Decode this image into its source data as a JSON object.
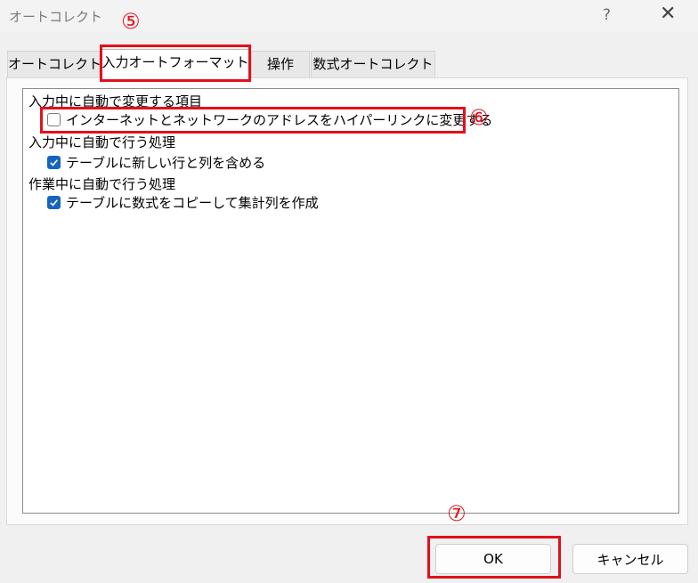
{
  "window": {
    "title": "オートコレクト",
    "help_glyph": "?",
    "close_glyph": "✕"
  },
  "tabs": [
    {
      "label": "オートコレクト"
    },
    {
      "label": "入力オートフォーマット"
    },
    {
      "label": "操作"
    },
    {
      "label": "数式オートコレクト"
    }
  ],
  "sections": [
    {
      "heading": "入力中に自動で変更する項目",
      "options": [
        {
          "label": "インターネットとネットワークのアドレスをハイパーリンクに変更する",
          "checked": false
        }
      ]
    },
    {
      "heading": "入力中に自動で行う処理",
      "options": [
        {
          "label": "テーブルに新しい行と列を含める",
          "checked": true
        }
      ]
    },
    {
      "heading": "作業中に自動で行う処理",
      "options": [
        {
          "label": "テーブルに数式をコピーして集計列を作成",
          "checked": true
        }
      ]
    }
  ],
  "buttons": {
    "ok": "OK",
    "cancel": "キャンセル"
  },
  "annotations": {
    "tab_marker": "⑤",
    "checkbox_marker": "⑥",
    "ok_marker": "⑦",
    "highlight_color": "#e2101a"
  }
}
